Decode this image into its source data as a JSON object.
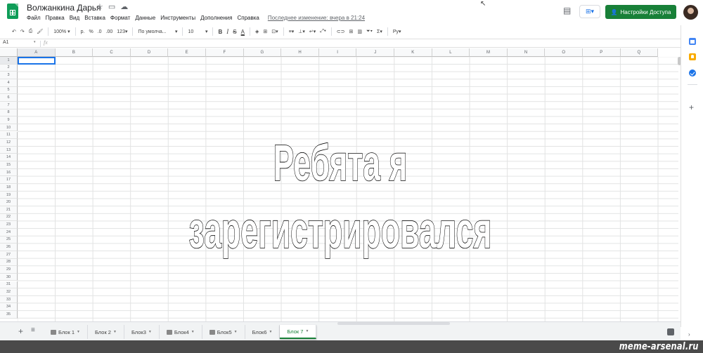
{
  "header": {
    "doc_title": "Волжанкина Дарья",
    "title_icons": [
      "star-icon",
      "folder-icon",
      "cloud-icon"
    ],
    "menu": [
      "Файл",
      "Правка",
      "Вид",
      "Вставка",
      "Формат",
      "Данные",
      "Инструменты",
      "Дополнения",
      "Справка"
    ],
    "last_edit": "Последнее изменение: вчера в 21:24",
    "share_label": "Настройки Доступа",
    "brand_color": "#188038"
  },
  "toolbar": {
    "zoom": "100%",
    "currency": "р.",
    "percent": "%",
    "decimal_less": ".0",
    "decimal_more": ".00",
    "format_more": "123",
    "font": "По умолча...",
    "font_size": "10",
    "bold": "B",
    "italic": "I",
    "strike": "S",
    "text_color": "A"
  },
  "formula_bar": {
    "cell_ref": "A1",
    "fx": "fx",
    "content": ""
  },
  "grid": {
    "columns": [
      "A",
      "B",
      "C",
      "D",
      "E",
      "F",
      "G",
      "H",
      "I",
      "J",
      "K",
      "L",
      "M",
      "N",
      "O",
      "P",
      "Q"
    ],
    "rows": [
      "1",
      "2",
      "3",
      "4",
      "5",
      "6",
      "7",
      "8",
      "9",
      "10",
      "11",
      "12",
      "13",
      "14",
      "15",
      "16",
      "17",
      "18",
      "19",
      "20",
      "21",
      "22",
      "23",
      "24",
      "25",
      "26",
      "27",
      "28",
      "29",
      "30",
      "31",
      "32",
      "33",
      "34",
      "35"
    ],
    "selected": "A1"
  },
  "sheets": {
    "tabs": [
      {
        "label": "Блок 1",
        "locked": true,
        "caret": true
      },
      {
        "label": "Блок 2",
        "locked": false,
        "caret": true
      },
      {
        "label": "Блок3",
        "locked": false,
        "caret": true
      },
      {
        "label": "Блок4",
        "locked": true,
        "caret": true
      },
      {
        "label": "Блок5",
        "locked": true,
        "caret": true
      },
      {
        "label": "Блок6",
        "locked": false,
        "caret": true
      },
      {
        "label": "Блок 7",
        "locked": false,
        "caret": true
      }
    ],
    "active": "Блок 7"
  },
  "caption": {
    "line1": "Ребята я",
    "line2": "зарегистрировался"
  },
  "watermark": "meme-arsenal.ru"
}
